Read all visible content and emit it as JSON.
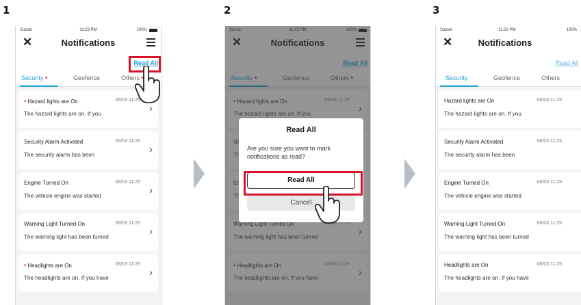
{
  "steps": [
    "1",
    "2",
    "3"
  ],
  "status": {
    "signal": "Suzuki",
    "time": "11:23 PM",
    "battery": "100%"
  },
  "header": {
    "title": "Notifications",
    "read_all": "Read All"
  },
  "tabs": [
    {
      "label": "Security",
      "dot": "•"
    },
    {
      "label": "Geofence",
      "dot": ""
    },
    {
      "label": "Others",
      "dot": "•"
    }
  ],
  "notifications": [
    {
      "title": "Hazard lights are On",
      "date": "06/03 11:25",
      "desc": "The hazard lights are on. If you",
      "unread": "•"
    },
    {
      "title": "Security Alarm Activated",
      "date": "06/03 11:25",
      "desc": "The security alarm has been",
      "unread": ""
    },
    {
      "title": "Engine Turned On",
      "date": "06/03 11:25",
      "desc": "The vehicle engine was started",
      "unread": ""
    },
    {
      "title": "Warning Light Turned On",
      "date": "06/03 11:25",
      "desc": "The warning light has been turned",
      "unread": ""
    },
    {
      "title": "Headlights are On",
      "date": "06/03 11:25",
      "desc": "The headlights are on. If you have",
      "unread": "•"
    }
  ],
  "dialog": {
    "title": "Read All",
    "message": "Are you sure you want to mark notifications as read?",
    "confirm": "Read All",
    "cancel": "Cancel"
  },
  "colors": {
    "accent": "#1fa0d3",
    "highlight": "#d7132a",
    "unread_dot": "#d6242a"
  },
  "icons": [
    "close-icon",
    "filter-icon",
    "chevron-right-icon",
    "hand-pointer-icon",
    "next-step-arrow-icon"
  ]
}
